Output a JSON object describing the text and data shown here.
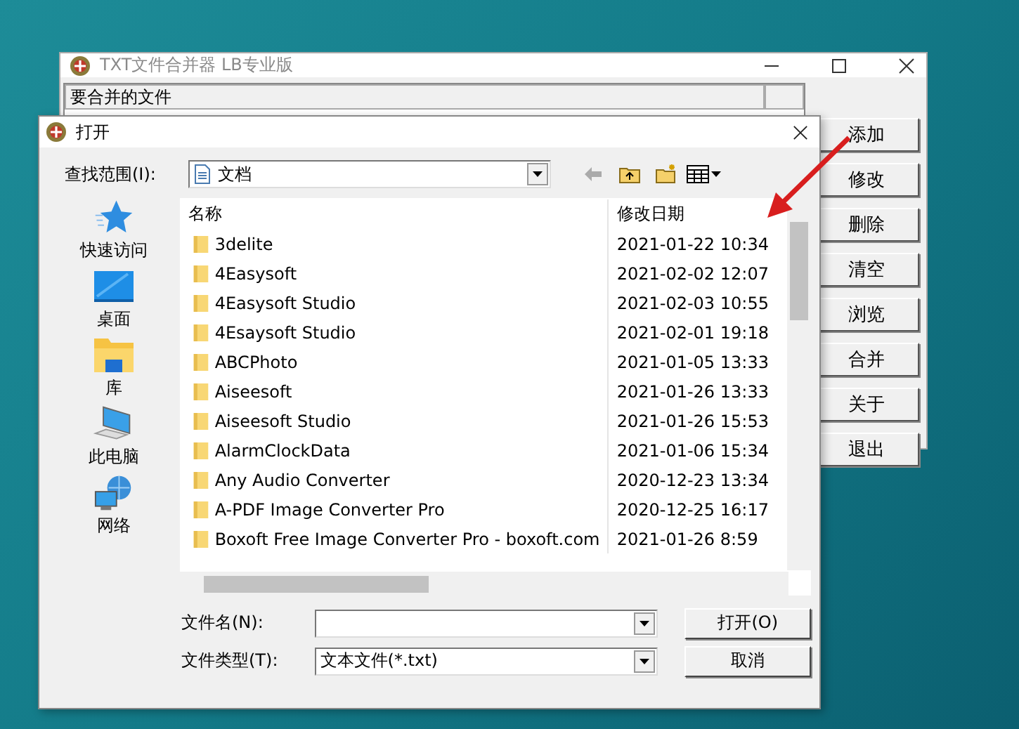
{
  "main_window": {
    "title": "TXT文件合并器 LB专业版",
    "active": false,
    "list_header": "要合并的文件",
    "buttons": [
      "添加",
      "修改",
      "删除",
      "清空",
      "浏览",
      "合并",
      "关于",
      "退出"
    ]
  },
  "dialog": {
    "title": "打开",
    "look_in_label": "查找范围(I):",
    "look_in_value": "文档",
    "places": [
      {
        "label": "快速访问",
        "kind": "star"
      },
      {
        "label": "桌面",
        "kind": "desktop"
      },
      {
        "label": "库",
        "kind": "library"
      },
      {
        "label": "此电脑",
        "kind": "computer"
      },
      {
        "label": "网络",
        "kind": "network"
      }
    ],
    "columns": [
      "名称",
      "修改日期"
    ],
    "files": [
      {
        "name": "3delite",
        "date": "2021-01-22 10:34"
      },
      {
        "name": "4Easysoft",
        "date": "2021-02-02 12:07"
      },
      {
        "name": "4Easysoft Studio",
        "date": "2021-02-03 10:55"
      },
      {
        "name": "4Esaysoft Studio",
        "date": "2021-02-01 19:18"
      },
      {
        "name": "ABCPhoto",
        "date": "2021-01-05 13:33"
      },
      {
        "name": "Aiseesoft",
        "date": "2021-01-26 13:33"
      },
      {
        "name": "Aiseesoft Studio",
        "date": "2021-01-26 15:53"
      },
      {
        "name": "AlarmClockData",
        "date": "2021-01-06 15:34"
      },
      {
        "name": "Any Audio Converter",
        "date": "2020-12-23 13:34"
      },
      {
        "name": "A-PDF Image Converter Pro",
        "date": "2020-12-25 16:17"
      },
      {
        "name": "Boxoft Free Image Converter Pro - boxoft.com",
        "date": "2021-01-26 8:59"
      }
    ],
    "filename_label": "文件名(N):",
    "filetype_label": "文件类型(T):",
    "filetype_value": "文本文件(*.txt)",
    "open_button": "打开(O)",
    "cancel_button": "取消"
  }
}
